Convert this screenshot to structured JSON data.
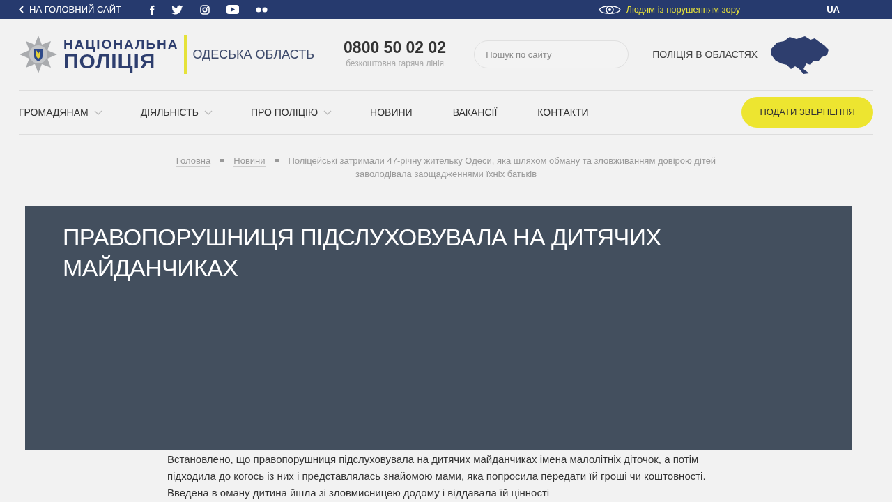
{
  "top_bar": {
    "back_link": "НА ГОЛОВНИЙ САЙТ",
    "accessibility_link": "Людям із порушенням зору",
    "language": "UA"
  },
  "header": {
    "logo_line1": "НАЦІОНАЛЬНА",
    "logo_line2": "ПОЛІЦІЯ",
    "region": "ОДЕСЬКА ОБЛАСТЬ",
    "hotline_number": "0800 50 02 02",
    "hotline_caption": "безкоштовна гаряча лінія",
    "search": {
      "placeholder": "Пошук по сайту"
    },
    "regions_link": "ПОЛІЦІЯ В ОБЛАСТЯХ"
  },
  "nav": {
    "items": [
      {
        "label": "ГРОМАДЯНАМ",
        "dropdown": true
      },
      {
        "label": "ДІЯЛЬНІСТЬ",
        "dropdown": true
      },
      {
        "label": "ПРО ПОЛІЦІЮ",
        "dropdown": true
      },
      {
        "label": "НОВИНИ",
        "dropdown": false
      },
      {
        "label": "ВАКАНСІЇ",
        "dropdown": false
      },
      {
        "label": "КОНТАКТИ",
        "dropdown": false
      }
    ],
    "cta_button": "ПОДАТИ ЗВЕРНЕННЯ"
  },
  "breadcrumb": [
    "Головна",
    "Новини",
    "Поліцейські затримали 47-річну жительку Одеси, яка шляхом обману та зловживанням довірою дітей заволодівала заощадженнями їхніх батьків"
  ],
  "article": {
    "body": "Встановлено, що правопорушниця підслуховувала на дитячих майданчиках імена малолітніх діточок, а потім підходила до когось із них і представлялась знайомою мами, яка попросила передати їй гроші чи коштовності. Введена в оману дитина йшла зі зловмисницею додому і віддавала їй цінності"
  },
  "overlay_caption": "ПРАВОПОРУШНИЦЯ ПІДСЛУХОВУВАЛА НА ДИТЯЧИХ МАЙДАНЧИКАХ"
}
